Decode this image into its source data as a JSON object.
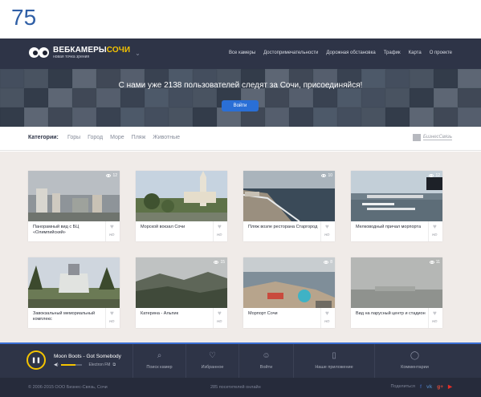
{
  "slide_number": "75",
  "header": {
    "logo_title_part1": "ВЕБКАМЕРЫ",
    "logo_title_part2": "СОЧИ",
    "logo_subtitle": "новая точка зрения",
    "nav": [
      "Все камеры",
      "Достопримечательности",
      "Дорожная обстановка",
      "Трафик",
      "Карта",
      "О проекте"
    ]
  },
  "hero": {
    "text": "С нами уже 2138 пользователей следят за Сочи, присоединяйся!",
    "login_label": "Войти"
  },
  "categories": {
    "label": "Категории:",
    "items": [
      "Горы",
      "Город",
      "Море",
      "Пляж",
      "Животные"
    ],
    "partner": "БизнесСвязь"
  },
  "cameras": [
    {
      "title": "Панорамный вид с БЦ «Олимпийский»",
      "views": "12",
      "hd": "HD",
      "scene": "city-grey"
    },
    {
      "title": "Морской вокзал Сочи",
      "views": "",
      "hd": "HD",
      "scene": "station"
    },
    {
      "title": "Пляж возле ресторана Старгород",
      "views": "10",
      "hd": "HD",
      "scene": "beach"
    },
    {
      "title": "Мелководный причал морпорта",
      "views": "12",
      "hd": "HD",
      "scene": "port"
    },
    {
      "title": "Завокзальный мемориальный комплекс",
      "views": "",
      "hd": "HD",
      "scene": "memorial"
    },
    {
      "title": "Катерина - Альпик",
      "views": "15",
      "hd": "HD",
      "scene": "mountain"
    },
    {
      "title": "Морпорт Сочи",
      "views": "8",
      "hd": "HD",
      "scene": "seaport"
    },
    {
      "title": "Вид на парусный центр и стадион",
      "views": "11",
      "hd": "HD",
      "scene": "fog"
    }
  ],
  "player": {
    "track": "Moon Boots - Got Somebody",
    "station": "Electron FM",
    "volume": 0.7
  },
  "bottom_nav": [
    {
      "label": "Поиск камер",
      "icon": "search-icon"
    },
    {
      "label": "Избранное",
      "icon": "heart-icon"
    },
    {
      "label": "Войти",
      "icon": "user-icon"
    },
    {
      "label": "Наше приложение",
      "icon": "phone-icon"
    },
    {
      "label": "Комментарии",
      "icon": "comment-icon"
    }
  ],
  "footer": {
    "copyright": "© 2006-2015 ООО Бизнес-Связь, Сочи",
    "online": "285 посетителей онлайн",
    "share_label": "Поделиться",
    "socials": [
      {
        "name": "facebook",
        "glyph": "f",
        "color": "#3b5998"
      },
      {
        "name": "vk",
        "glyph": "vk",
        "color": "#4a76a8"
      },
      {
        "name": "google-plus",
        "glyph": "g+",
        "color": "#dd4b39"
      },
      {
        "name": "youtube",
        "glyph": "▶",
        "color": "#e52d27"
      }
    ]
  }
}
